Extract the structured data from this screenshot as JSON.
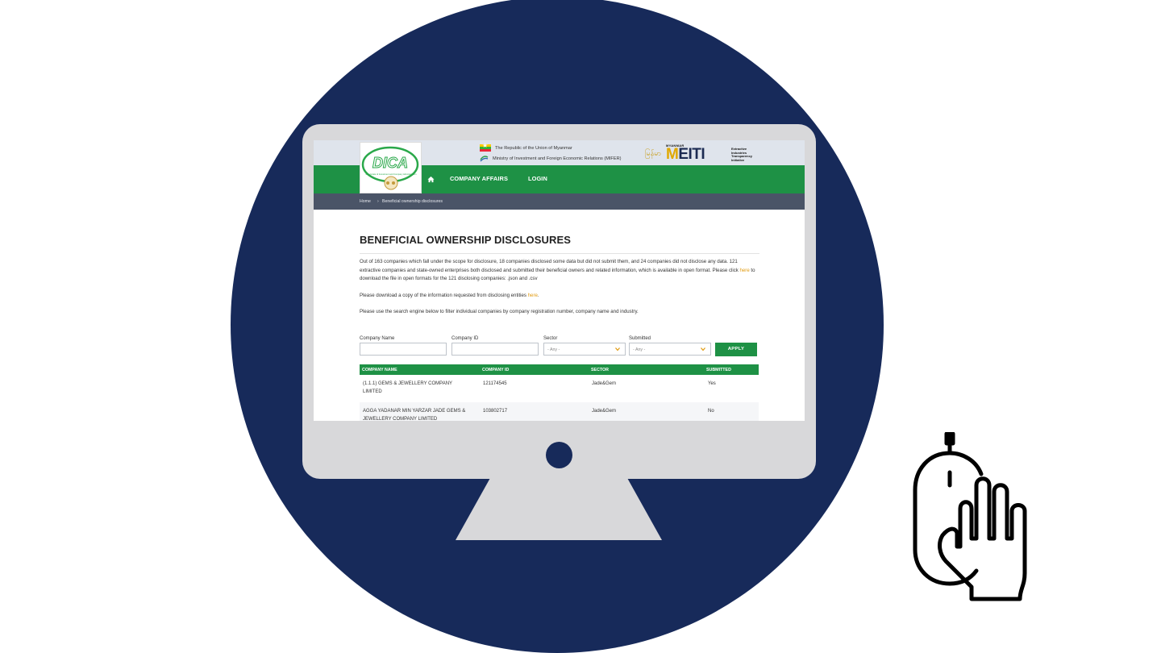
{
  "colors": {
    "navy": "#172a5a",
    "site_green": "#1e9145",
    "breadcrumb_bg": "#4a5467",
    "link_orange": "#e19a0d",
    "monitor_gray": "#d8d8da"
  },
  "header": {
    "logo_text": "DICA",
    "logo_subtext": "Directorate of Investment and Company Administration",
    "republic": "The Republic of the Union of Myanmar",
    "ministry": "Ministry of Investment and Foreign Economic Relations (MIFER)",
    "script_text": "မြန်မာ",
    "meiti_small": "MYANMAR",
    "meiti_m": "M",
    "meiti_eiti": "EITI",
    "meiti_desc": "Extractive\nIndustries\nTransparency\nInitiative"
  },
  "nav": {
    "home_icon": "home-icon",
    "items": [
      "COMPANY AFFAIRS",
      "LOGIN"
    ]
  },
  "breadcrumb": {
    "home": "Home",
    "separator": "›",
    "current": "Beneficial ownership disclosures"
  },
  "page": {
    "title": "BENEFICIAL OWNERSHIP DISCLOSURES",
    "para1_before": "Out of 163 companies which fall under the scope for disclosure, 18 companies disclosed some data but did not submit them, and 24 companies did not disclose any data. 121 extractive companies and state-owned enterprises both disclosed and submitted their beneficial owners and related information, which is available in open format. Please click ",
    "para1_link": "here",
    "para1_after": " to download the file in open formats for the 121 disclosing companies: .json and .csv",
    "para2_before": "Please download a copy of the information requested from disclosing entities ",
    "para2_link": "here",
    "para2_after": ".",
    "para3": "Please use the search engine below to filter individual companies by company registration number, company name and industry."
  },
  "filters": {
    "company_name_label": "Company Name",
    "company_name_value": "",
    "company_id_label": "Company ID",
    "company_id_value": "",
    "sector_label": "Sector",
    "sector_value": "- Any -",
    "submitted_label": "Submitted",
    "submitted_value": "- Any -",
    "apply_label": "APPLY"
  },
  "table": {
    "columns": [
      "COMPANY NAME",
      "COMPANY ID",
      "SECTOR",
      "SUBMITTED"
    ],
    "rows": [
      {
        "name": "(1.1.1) GEMS & JEWELLERY COMPANY LIMITED",
        "id": "121174545",
        "sector": "Jade&Gem",
        "submitted": "Yes"
      },
      {
        "name": "AGGA YADANAR MIN YARZAR JADE GEMS & JEWELLERY COMPANY LIMITED",
        "id": "103802717",
        "sector": "Jade&Gem",
        "submitted": "No"
      }
    ]
  }
}
